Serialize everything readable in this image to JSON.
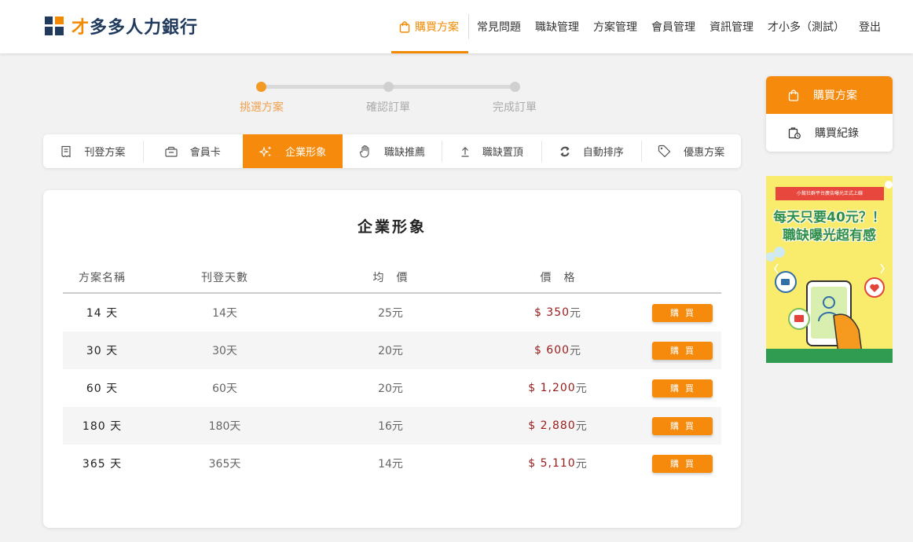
{
  "brand": {
    "logo_prefix": "才",
    "logo_rest": "多多人力銀行",
    "accent": "#f58a0c",
    "navy": "#1f3a5c"
  },
  "nav": {
    "items": [
      {
        "label": "購買方案",
        "active": true
      },
      {
        "label": "常見問題"
      },
      {
        "label": "職缺管理"
      },
      {
        "label": "方案管理"
      },
      {
        "label": "會員管理"
      },
      {
        "label": "資訊管理"
      },
      {
        "label": "才小多（測試）"
      },
      {
        "label": "登出"
      }
    ]
  },
  "steps": [
    {
      "label": "挑選方案",
      "active": true
    },
    {
      "label": "確認訂單"
    },
    {
      "label": "完成訂單"
    }
  ],
  "tabs": [
    {
      "label": "刊登方案",
      "icon": "receipt-icon"
    },
    {
      "label": "會員卡",
      "icon": "card-icon"
    },
    {
      "label": "企業形象",
      "icon": "sparkle-icon",
      "active": true
    },
    {
      "label": "職缺推薦",
      "icon": "hand-icon"
    },
    {
      "label": "職缺置頂",
      "icon": "arrow-up-icon"
    },
    {
      "label": "自動排序",
      "icon": "refresh-icon"
    },
    {
      "label": "優惠方案",
      "icon": "tag-icon"
    }
  ],
  "plan": {
    "title": "企業形象",
    "headers": [
      "方案名稱",
      "刊登天數",
      "均　價",
      "價　格"
    ],
    "buy_label": "購買",
    "rows": [
      {
        "name": "14 天",
        "days": "14天",
        "avg": "25元",
        "price": "$ 350",
        "unit": "元"
      },
      {
        "name": "30 天",
        "days": "30天",
        "avg": "20元",
        "price": "$ 600",
        "unit": "元"
      },
      {
        "name": "60 天",
        "days": "60天",
        "avg": "20元",
        "price": "$ 1,200",
        "unit": "元"
      },
      {
        "name": "180 天",
        "days": "180天",
        "avg": "16元",
        "price": "$ 2,880",
        "unit": "元"
      },
      {
        "name": "365 天",
        "days": "365天",
        "avg": "14元",
        "price": "$ 5,110",
        "unit": "元"
      }
    ]
  },
  "side": {
    "items": [
      {
        "label": "購買方案",
        "icon": "shopping-bag-icon",
        "active": true
      },
      {
        "label": "購買紀錄",
        "icon": "order-history-icon"
      }
    ]
  },
  "ad": {
    "ribbon": "小幫社群平台廣告曝光正式上線",
    "line1": "每天只要40元？！",
    "line2": "職缺曝光超有感"
  }
}
